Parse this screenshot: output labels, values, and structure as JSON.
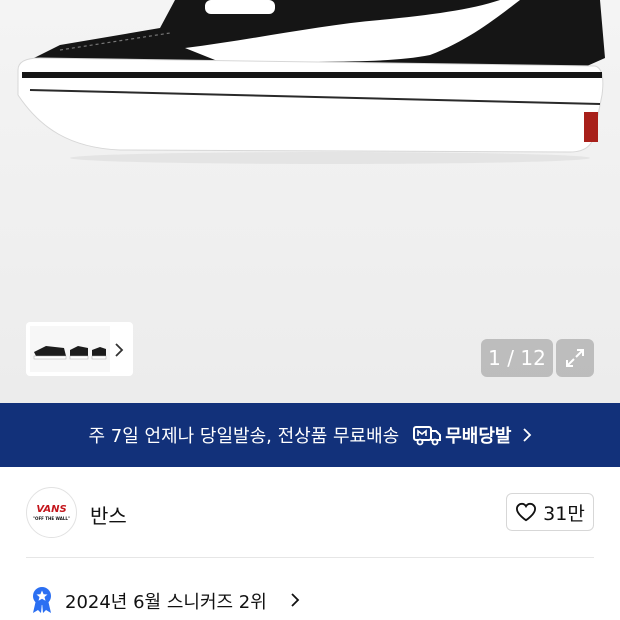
{
  "gallery": {
    "counter": "1 / 12"
  },
  "banner": {
    "text": "주 7일 언제나 당일발송, 전상품 무료배송",
    "brand": "무배당발"
  },
  "store": {
    "logo_text": "VANS",
    "logo_subtext": "\"OFF THE WALL\"",
    "name": "반스",
    "likes": "31만"
  },
  "ranking": {
    "text": "2024년 6월 스니커즈 2위"
  },
  "colors": {
    "banner_bg": "#12317a",
    "badge_blue": "#2b6ff2",
    "logo_red": "#c4161c"
  }
}
